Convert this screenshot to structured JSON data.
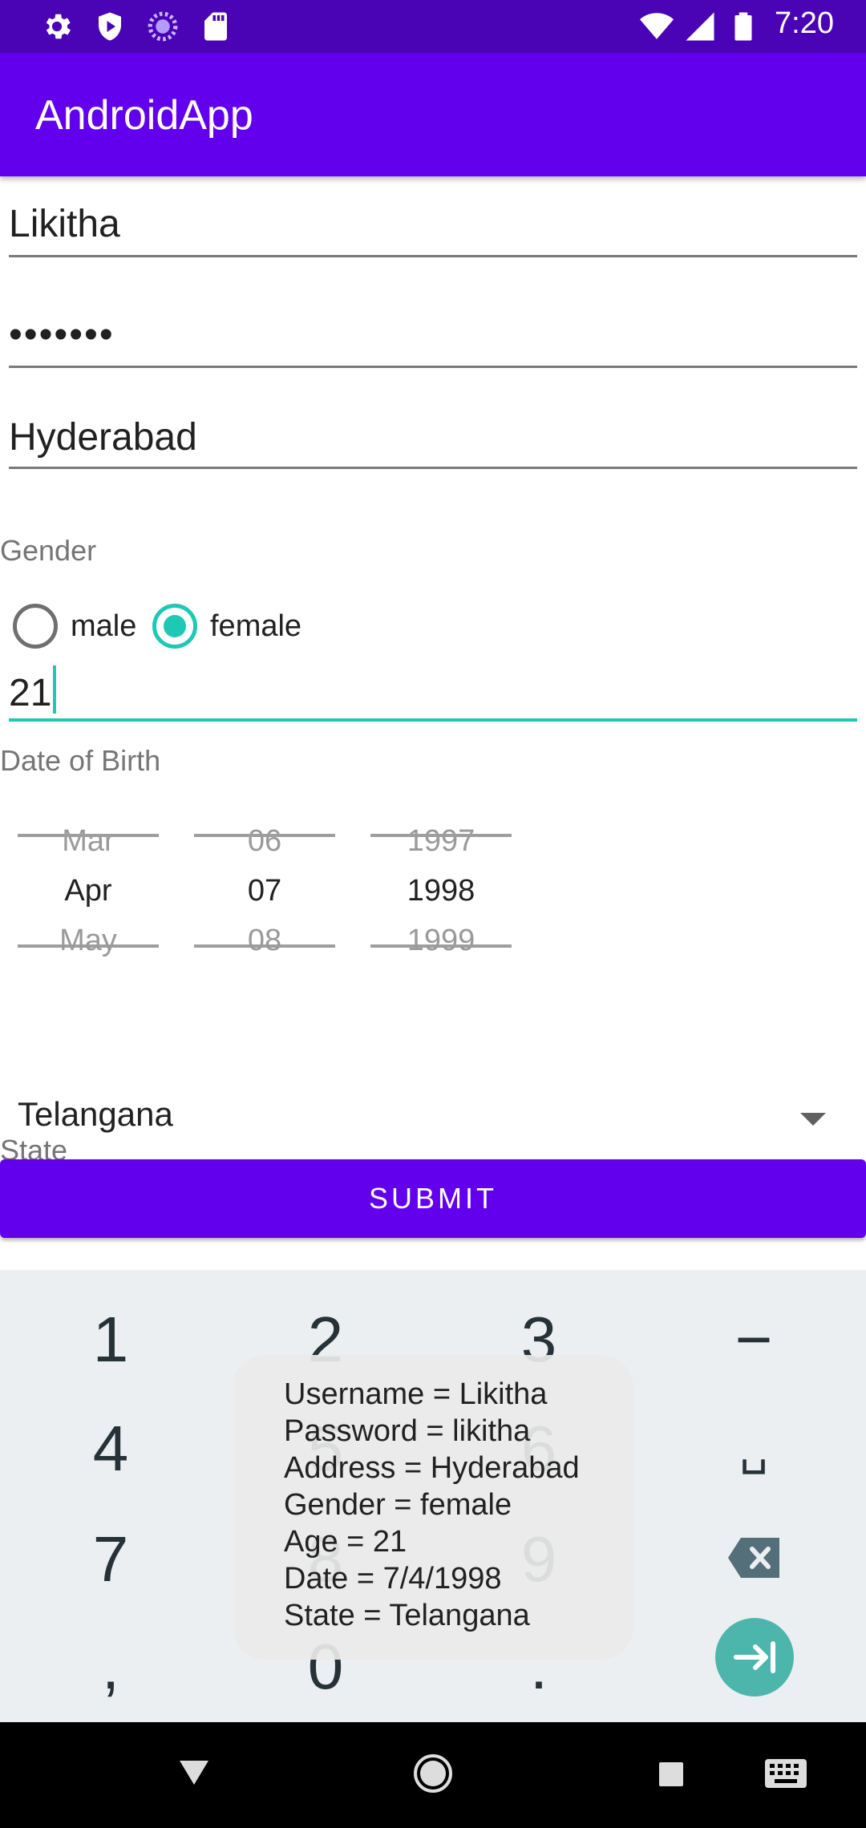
{
  "status_bar": {
    "time": "7:20",
    "icons_left": [
      "settings-icon",
      "shield-icon",
      "loading-icon",
      "sd-card-icon"
    ],
    "icons_right": [
      "wifi-icon",
      "signal-icon",
      "battery-icon"
    ]
  },
  "app_bar": {
    "title": "AndroidApp"
  },
  "form": {
    "username": "Likitha",
    "password_mask": "•••••••",
    "address": "Hyderabad",
    "gender_label": "Gender",
    "gender_options": [
      {
        "label": "male",
        "checked": false
      },
      {
        "label": "female",
        "checked": true
      }
    ],
    "age": "21",
    "dob_label": "Date of Birth",
    "date_picker": {
      "month": {
        "prev": "Mar",
        "current": "Apr",
        "next": "May"
      },
      "day": {
        "prev": "06",
        "current": "07",
        "next": "08"
      },
      "year": {
        "prev": "1997",
        "current": "1998",
        "next": "1999"
      }
    },
    "state_value": "Telangana",
    "state_label": "State",
    "submit_label": "SUBMIT"
  },
  "keyboard": {
    "keys": [
      "1",
      "2",
      "3",
      "−",
      "4",
      "5",
      "6",
      "␣",
      "7",
      "8",
      "9",
      "backspace",
      ",",
      "0",
      ".",
      "next"
    ]
  },
  "toast": {
    "lines": [
      "Username = Likitha",
      "Password = likitha",
      "Address = Hyderabad",
      "Gender = female",
      "Age = 21",
      "Date = 7/4/1998",
      "State = Telangana"
    ]
  },
  "colors": {
    "status_bar": "#4a04b6",
    "primary": "#6200ee",
    "accent": "#1fc8b4",
    "keyboard_bg": "#eceff1"
  }
}
